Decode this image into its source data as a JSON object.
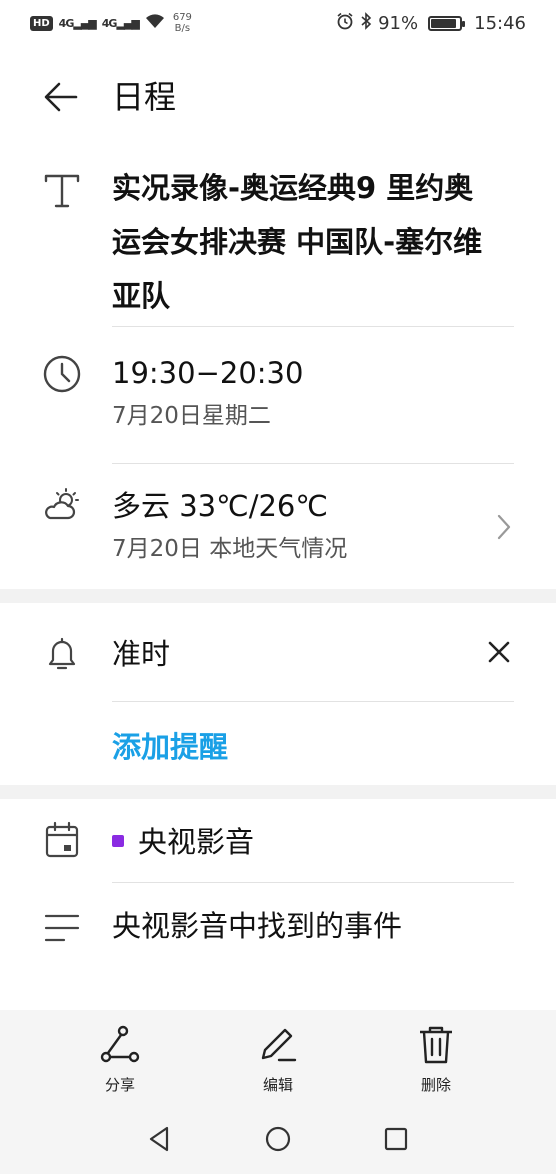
{
  "status_bar": {
    "hd_label": "HD",
    "signal1": "4G",
    "signal2": "4G",
    "net_speed_value": "679",
    "net_speed_unit": "B/s",
    "battery_percent": "91%",
    "battery_level": 0.91,
    "time": "15:46"
  },
  "header": {
    "title": "日程"
  },
  "event": {
    "title": "实况录像-奥运经典9  里约奥运会女排决赛 中国队-塞尔维亚队",
    "title_lines": [
      "实况录像-奥运经典9  里约奥",
      "运会女排决赛 中国队-塞尔维",
      "亚队"
    ],
    "time_range": "19:30−20:30",
    "date": "7月20日星期二",
    "weather_main": "多云 33℃/26℃",
    "weather_sub": "7月20日 本地天气情况",
    "reminder": "准时",
    "add_reminder": "添加提醒",
    "calendar_name": "央视影音",
    "calendar_color": "#8a2be2",
    "description": "央视影音中找到的事件"
  },
  "toolbar": {
    "share_label": "分享",
    "edit_label": "编辑",
    "delete_label": "删除"
  },
  "icons": {
    "back": "arrow-left-icon",
    "title": "text-t-icon",
    "time": "clock-icon",
    "weather": "partly-cloudy-icon",
    "reminder": "bell-icon",
    "calendar": "calendar-icon",
    "notes": "notes-lines-icon"
  }
}
